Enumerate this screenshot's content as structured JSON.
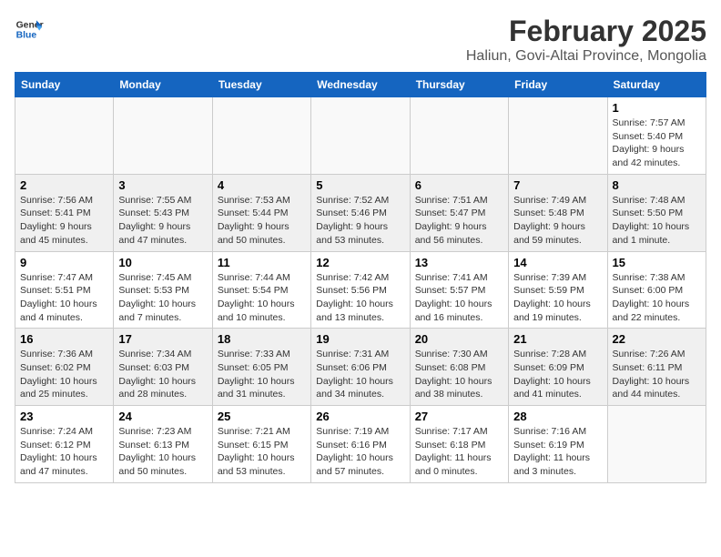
{
  "header": {
    "logo_general": "General",
    "logo_blue": "Blue",
    "month_year": "February 2025",
    "location": "Haliun, Govi-Altai Province, Mongolia"
  },
  "weekdays": [
    "Sunday",
    "Monday",
    "Tuesday",
    "Wednesday",
    "Thursday",
    "Friday",
    "Saturday"
  ],
  "weeks": [
    [
      {
        "day": "",
        "info": ""
      },
      {
        "day": "",
        "info": ""
      },
      {
        "day": "",
        "info": ""
      },
      {
        "day": "",
        "info": ""
      },
      {
        "day": "",
        "info": ""
      },
      {
        "day": "",
        "info": ""
      },
      {
        "day": "1",
        "info": "Sunrise: 7:57 AM\nSunset: 5:40 PM\nDaylight: 9 hours and 42 minutes."
      }
    ],
    [
      {
        "day": "2",
        "info": "Sunrise: 7:56 AM\nSunset: 5:41 PM\nDaylight: 9 hours and 45 minutes."
      },
      {
        "day": "3",
        "info": "Sunrise: 7:55 AM\nSunset: 5:43 PM\nDaylight: 9 hours and 47 minutes."
      },
      {
        "day": "4",
        "info": "Sunrise: 7:53 AM\nSunset: 5:44 PM\nDaylight: 9 hours and 50 minutes."
      },
      {
        "day": "5",
        "info": "Sunrise: 7:52 AM\nSunset: 5:46 PM\nDaylight: 9 hours and 53 minutes."
      },
      {
        "day": "6",
        "info": "Sunrise: 7:51 AM\nSunset: 5:47 PM\nDaylight: 9 hours and 56 minutes."
      },
      {
        "day": "7",
        "info": "Sunrise: 7:49 AM\nSunset: 5:48 PM\nDaylight: 9 hours and 59 minutes."
      },
      {
        "day": "8",
        "info": "Sunrise: 7:48 AM\nSunset: 5:50 PM\nDaylight: 10 hours and 1 minute."
      }
    ],
    [
      {
        "day": "9",
        "info": "Sunrise: 7:47 AM\nSunset: 5:51 PM\nDaylight: 10 hours and 4 minutes."
      },
      {
        "day": "10",
        "info": "Sunrise: 7:45 AM\nSunset: 5:53 PM\nDaylight: 10 hours and 7 minutes."
      },
      {
        "day": "11",
        "info": "Sunrise: 7:44 AM\nSunset: 5:54 PM\nDaylight: 10 hours and 10 minutes."
      },
      {
        "day": "12",
        "info": "Sunrise: 7:42 AM\nSunset: 5:56 PM\nDaylight: 10 hours and 13 minutes."
      },
      {
        "day": "13",
        "info": "Sunrise: 7:41 AM\nSunset: 5:57 PM\nDaylight: 10 hours and 16 minutes."
      },
      {
        "day": "14",
        "info": "Sunrise: 7:39 AM\nSunset: 5:59 PM\nDaylight: 10 hours and 19 minutes."
      },
      {
        "day": "15",
        "info": "Sunrise: 7:38 AM\nSunset: 6:00 PM\nDaylight: 10 hours and 22 minutes."
      }
    ],
    [
      {
        "day": "16",
        "info": "Sunrise: 7:36 AM\nSunset: 6:02 PM\nDaylight: 10 hours and 25 minutes."
      },
      {
        "day": "17",
        "info": "Sunrise: 7:34 AM\nSunset: 6:03 PM\nDaylight: 10 hours and 28 minutes."
      },
      {
        "day": "18",
        "info": "Sunrise: 7:33 AM\nSunset: 6:05 PM\nDaylight: 10 hours and 31 minutes."
      },
      {
        "day": "19",
        "info": "Sunrise: 7:31 AM\nSunset: 6:06 PM\nDaylight: 10 hours and 34 minutes."
      },
      {
        "day": "20",
        "info": "Sunrise: 7:30 AM\nSunset: 6:08 PM\nDaylight: 10 hours and 38 minutes."
      },
      {
        "day": "21",
        "info": "Sunrise: 7:28 AM\nSunset: 6:09 PM\nDaylight: 10 hours and 41 minutes."
      },
      {
        "day": "22",
        "info": "Sunrise: 7:26 AM\nSunset: 6:11 PM\nDaylight: 10 hours and 44 minutes."
      }
    ],
    [
      {
        "day": "23",
        "info": "Sunrise: 7:24 AM\nSunset: 6:12 PM\nDaylight: 10 hours and 47 minutes."
      },
      {
        "day": "24",
        "info": "Sunrise: 7:23 AM\nSunset: 6:13 PM\nDaylight: 10 hours and 50 minutes."
      },
      {
        "day": "25",
        "info": "Sunrise: 7:21 AM\nSunset: 6:15 PM\nDaylight: 10 hours and 53 minutes."
      },
      {
        "day": "26",
        "info": "Sunrise: 7:19 AM\nSunset: 6:16 PM\nDaylight: 10 hours and 57 minutes."
      },
      {
        "day": "27",
        "info": "Sunrise: 7:17 AM\nSunset: 6:18 PM\nDaylight: 11 hours and 0 minutes."
      },
      {
        "day": "28",
        "info": "Sunrise: 7:16 AM\nSunset: 6:19 PM\nDaylight: 11 hours and 3 minutes."
      },
      {
        "day": "",
        "info": ""
      }
    ]
  ]
}
